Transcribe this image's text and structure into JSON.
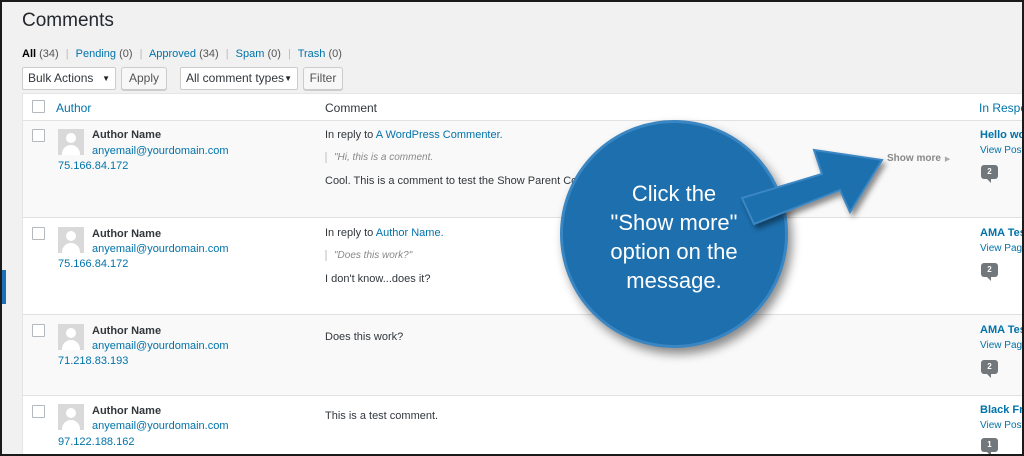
{
  "page": {
    "title": "Comments"
  },
  "filters": [
    {
      "label": "All",
      "count": "(34)",
      "current": true
    },
    {
      "label": "Pending",
      "count": "(0)"
    },
    {
      "label": "Approved",
      "count": "(34)"
    },
    {
      "label": "Spam",
      "count": "(0)"
    },
    {
      "label": "Trash",
      "count": "(0)"
    }
  ],
  "toolbar": {
    "bulk_actions": "Bulk Actions",
    "apply": "Apply",
    "comment_types": "All comment types",
    "filter": "Filter"
  },
  "table": {
    "headers": {
      "author": "Author",
      "comment": "Comment",
      "response": "In Response To"
    },
    "rows": [
      {
        "author_name": "Author Name",
        "email": "anyemail@yourdomain.com",
        "ip": "75.166.84.172",
        "reply_prefix": "In reply to",
        "reply_to": "A WordPress Commenter.",
        "quote": "\"Hi, this is a comment.",
        "text": "Cool. This is a comment to test the Show Parent Comment",
        "show_more": "Show more",
        "response_title": "Hello world!",
        "response_view": "View Post",
        "count": "2"
      },
      {
        "author_name": "Author Name",
        "email": "anyemail@yourdomain.com",
        "ip": "75.166.84.172",
        "reply_prefix": "In reply to",
        "reply_to": "Author Name.",
        "quote": "\"Does this work?\"",
        "text": "I don't know...does it?",
        "response_title": "AMA Test",
        "response_view": "View Page",
        "count": "2"
      },
      {
        "author_name": "Author Name",
        "email": "anyemail@yourdomain.com",
        "ip": "71.218.83.193",
        "text": "Does this work?",
        "response_title": "AMA Test",
        "response_view": "View Page",
        "count": "2"
      },
      {
        "author_name": "Author Name",
        "email": "anyemail@yourdomain.com",
        "ip": "97.122.188.162",
        "text": "This is a test comment.",
        "response_title": "Black Friday",
        "response_view": "View Post",
        "count": "1"
      }
    ]
  },
  "callout": {
    "lines": [
      "Click the",
      "\"Show more\"",
      "option on the",
      "message."
    ],
    "color": "#1d6fae"
  }
}
